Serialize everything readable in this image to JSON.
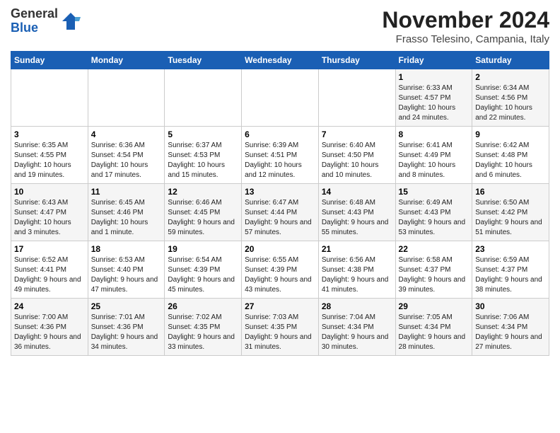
{
  "logo": {
    "general": "General",
    "blue": "Blue"
  },
  "header": {
    "month": "November 2024",
    "location": "Frasso Telesino, Campania, Italy"
  },
  "weekdays": [
    "Sunday",
    "Monday",
    "Tuesday",
    "Wednesday",
    "Thursday",
    "Friday",
    "Saturday"
  ],
  "weeks": [
    [
      {
        "day": "",
        "info": ""
      },
      {
        "day": "",
        "info": ""
      },
      {
        "day": "",
        "info": ""
      },
      {
        "day": "",
        "info": ""
      },
      {
        "day": "",
        "info": ""
      },
      {
        "day": "1",
        "info": "Sunrise: 6:33 AM\nSunset: 4:57 PM\nDaylight: 10 hours and 24 minutes."
      },
      {
        "day": "2",
        "info": "Sunrise: 6:34 AM\nSunset: 4:56 PM\nDaylight: 10 hours and 22 minutes."
      }
    ],
    [
      {
        "day": "3",
        "info": "Sunrise: 6:35 AM\nSunset: 4:55 PM\nDaylight: 10 hours and 19 minutes."
      },
      {
        "day": "4",
        "info": "Sunrise: 6:36 AM\nSunset: 4:54 PM\nDaylight: 10 hours and 17 minutes."
      },
      {
        "day": "5",
        "info": "Sunrise: 6:37 AM\nSunset: 4:53 PM\nDaylight: 10 hours and 15 minutes."
      },
      {
        "day": "6",
        "info": "Sunrise: 6:39 AM\nSunset: 4:51 PM\nDaylight: 10 hours and 12 minutes."
      },
      {
        "day": "7",
        "info": "Sunrise: 6:40 AM\nSunset: 4:50 PM\nDaylight: 10 hours and 10 minutes."
      },
      {
        "day": "8",
        "info": "Sunrise: 6:41 AM\nSunset: 4:49 PM\nDaylight: 10 hours and 8 minutes."
      },
      {
        "day": "9",
        "info": "Sunrise: 6:42 AM\nSunset: 4:48 PM\nDaylight: 10 hours and 6 minutes."
      }
    ],
    [
      {
        "day": "10",
        "info": "Sunrise: 6:43 AM\nSunset: 4:47 PM\nDaylight: 10 hours and 3 minutes."
      },
      {
        "day": "11",
        "info": "Sunrise: 6:45 AM\nSunset: 4:46 PM\nDaylight: 10 hours and 1 minute."
      },
      {
        "day": "12",
        "info": "Sunrise: 6:46 AM\nSunset: 4:45 PM\nDaylight: 9 hours and 59 minutes."
      },
      {
        "day": "13",
        "info": "Sunrise: 6:47 AM\nSunset: 4:44 PM\nDaylight: 9 hours and 57 minutes."
      },
      {
        "day": "14",
        "info": "Sunrise: 6:48 AM\nSunset: 4:43 PM\nDaylight: 9 hours and 55 minutes."
      },
      {
        "day": "15",
        "info": "Sunrise: 6:49 AM\nSunset: 4:43 PM\nDaylight: 9 hours and 53 minutes."
      },
      {
        "day": "16",
        "info": "Sunrise: 6:50 AM\nSunset: 4:42 PM\nDaylight: 9 hours and 51 minutes."
      }
    ],
    [
      {
        "day": "17",
        "info": "Sunrise: 6:52 AM\nSunset: 4:41 PM\nDaylight: 9 hours and 49 minutes."
      },
      {
        "day": "18",
        "info": "Sunrise: 6:53 AM\nSunset: 4:40 PM\nDaylight: 9 hours and 47 minutes."
      },
      {
        "day": "19",
        "info": "Sunrise: 6:54 AM\nSunset: 4:39 PM\nDaylight: 9 hours and 45 minutes."
      },
      {
        "day": "20",
        "info": "Sunrise: 6:55 AM\nSunset: 4:39 PM\nDaylight: 9 hours and 43 minutes."
      },
      {
        "day": "21",
        "info": "Sunrise: 6:56 AM\nSunset: 4:38 PM\nDaylight: 9 hours and 41 minutes."
      },
      {
        "day": "22",
        "info": "Sunrise: 6:58 AM\nSunset: 4:37 PM\nDaylight: 9 hours and 39 minutes."
      },
      {
        "day": "23",
        "info": "Sunrise: 6:59 AM\nSunset: 4:37 PM\nDaylight: 9 hours and 38 minutes."
      }
    ],
    [
      {
        "day": "24",
        "info": "Sunrise: 7:00 AM\nSunset: 4:36 PM\nDaylight: 9 hours and 36 minutes."
      },
      {
        "day": "25",
        "info": "Sunrise: 7:01 AM\nSunset: 4:36 PM\nDaylight: 9 hours and 34 minutes."
      },
      {
        "day": "26",
        "info": "Sunrise: 7:02 AM\nSunset: 4:35 PM\nDaylight: 9 hours and 33 minutes."
      },
      {
        "day": "27",
        "info": "Sunrise: 7:03 AM\nSunset: 4:35 PM\nDaylight: 9 hours and 31 minutes."
      },
      {
        "day": "28",
        "info": "Sunrise: 7:04 AM\nSunset: 4:34 PM\nDaylight: 9 hours and 30 minutes."
      },
      {
        "day": "29",
        "info": "Sunrise: 7:05 AM\nSunset: 4:34 PM\nDaylight: 9 hours and 28 minutes."
      },
      {
        "day": "30",
        "info": "Sunrise: 7:06 AM\nSunset: 4:34 PM\nDaylight: 9 hours and 27 minutes."
      }
    ]
  ]
}
